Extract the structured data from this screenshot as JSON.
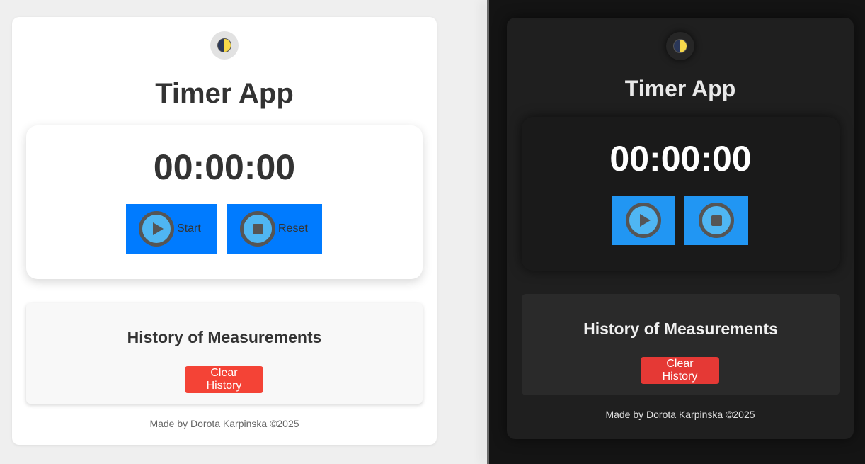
{
  "app": {
    "title": "Timer App",
    "timer_display": "00:00:00",
    "start_label": "Start",
    "reset_label": "Reset",
    "history_title": "History of Measurements",
    "clear_history_label": "Clear History",
    "footer": "Made by Dorota Karpinska ©2025"
  },
  "icons": {
    "theme_toggle": "half-moon-icon",
    "start": "play-icon",
    "reset": "stop-icon"
  },
  "colors": {
    "light_card": "#ffffff",
    "dark_card": "#1f1f1f",
    "primary_button_light": "#007bff",
    "primary_button_dark": "#2196f3",
    "danger": "#f44336"
  }
}
